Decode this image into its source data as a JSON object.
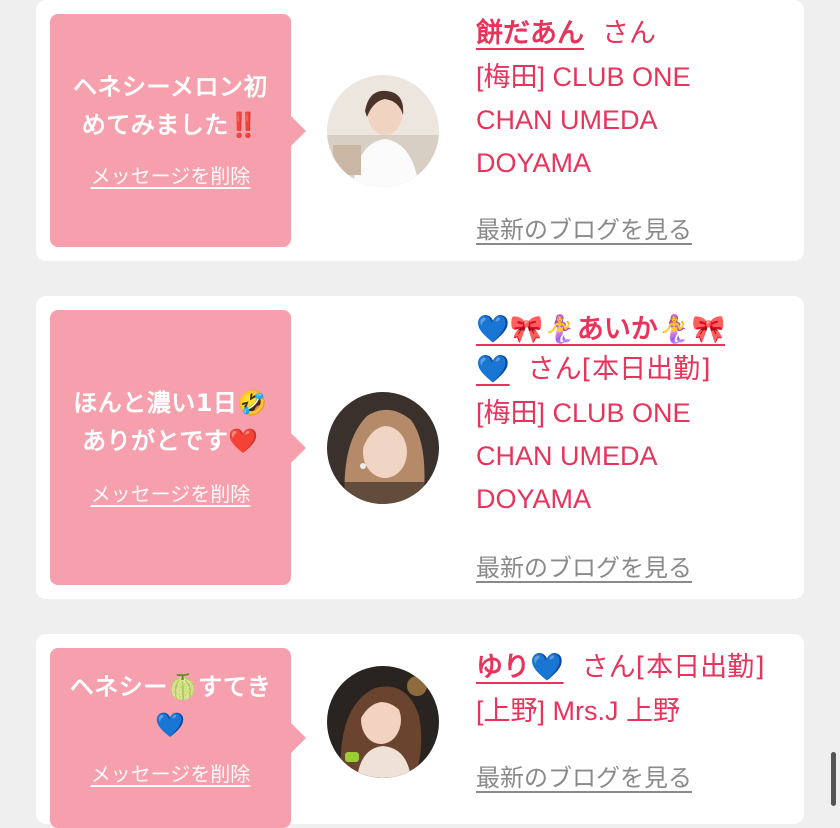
{
  "cards": [
    {
      "message_line1": "ヘネシーメロン初",
      "message_line2": "めてみました‼️",
      "delete_label": "メッセージを削除",
      "name": "餅だあん",
      "suffix": "さん",
      "shop_line1": "[梅田] CLUB ONE",
      "shop_line2": "CHAN UMEDA",
      "shop_line3": "DOYAMA",
      "blog_label": "最新のブログを見る"
    },
    {
      "message_line1": "ほんと濃い1日🤣",
      "message_line2": "ありがとです❤️",
      "delete_label": "メッセージを削除",
      "name_line1": "💙🎀🧜‍♀️あいか🧜‍♀️🎀",
      "name_line2": "💙",
      "suffix": "さん[本日出勤]",
      "shop_line1": "[梅田] CLUB ONE",
      "shop_line2": "CHAN UMEDA",
      "shop_line3": "DOYAMA",
      "blog_label": "最新のブログを見る"
    },
    {
      "message_line1": "ヘネシー🍈すてき",
      "message_line2": "💙",
      "delete_label": "メッセージを削除",
      "name": "ゆり💙",
      "suffix": "さん[本日出勤]",
      "shop_line1": "[上野] Mrs.J 上野",
      "blog_label": "最新のブログを見る"
    }
  ],
  "colors": {
    "bubble": "#f7a0ad",
    "accent": "#e8335b",
    "link_gray": "#8a8a8a",
    "page_bg": "#efefef"
  }
}
